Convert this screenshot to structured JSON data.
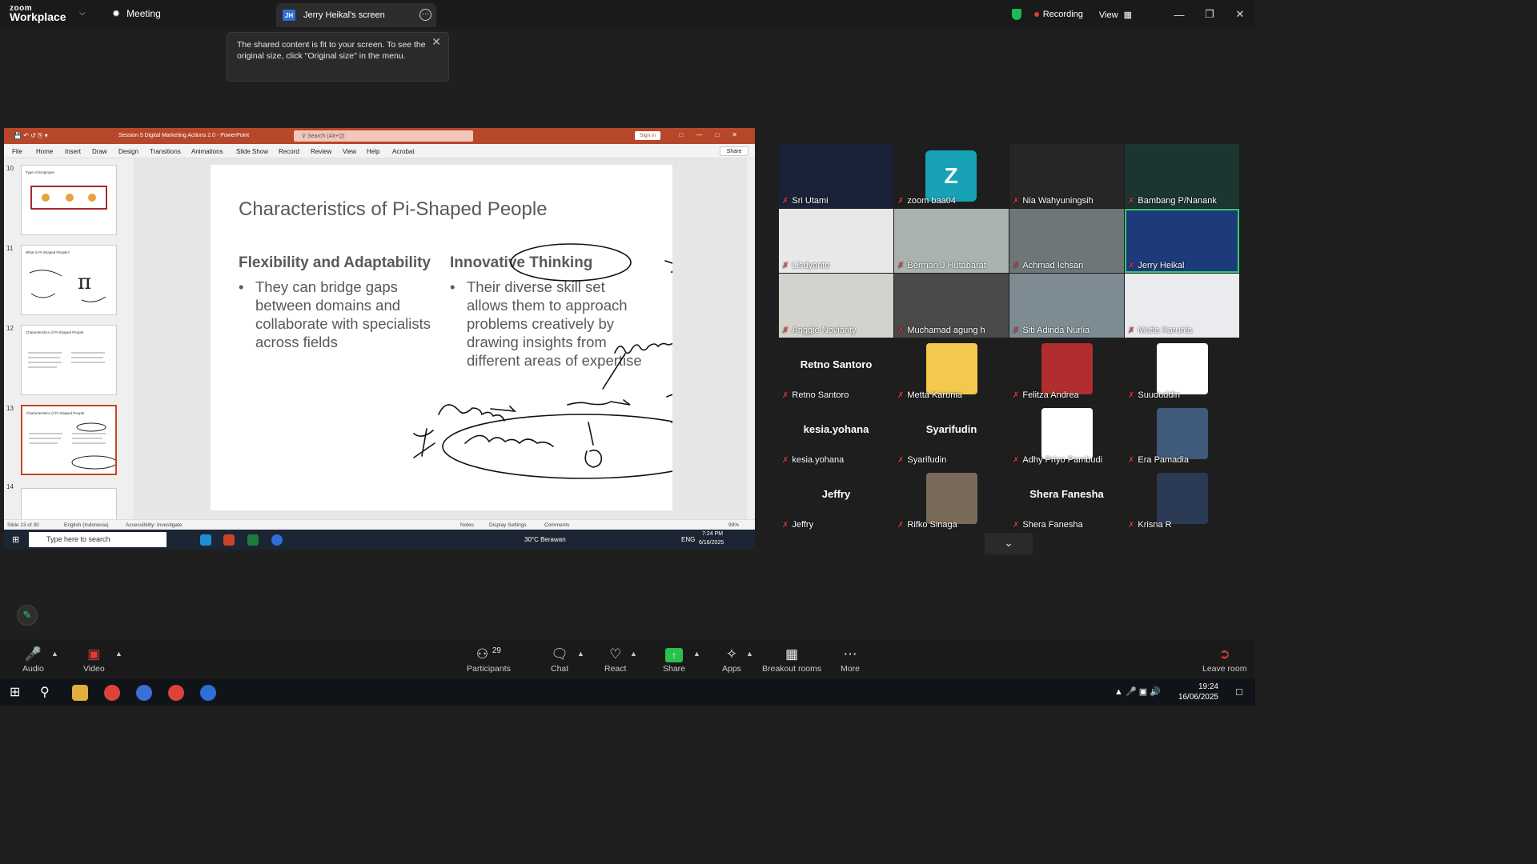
{
  "zoom": {
    "brand_line1": "zoom",
    "brand_line2": "Workplace",
    "meeting_tab": "Meeting",
    "screen_tab": "Jerry Heikal's screen",
    "screen_tab_badge": "JH",
    "recording": "Recording",
    "view": "View",
    "notice": "The shared content is fit to your screen. To see the original size, click \"Original size\" in the menu."
  },
  "ppt": {
    "title": "Session 5 Digital Marketing Actions 2.0  -  PowerPoint",
    "search_placeholder": "Search (Alt+Q)",
    "sign_in": "Sign in",
    "menu": [
      "File",
      "Home",
      "Insert",
      "Draw",
      "Design",
      "Transitions",
      "Animations",
      "Slide Show",
      "Record",
      "Review",
      "View",
      "Help",
      "Acrobat"
    ],
    "share": "Share",
    "thumbnails": [
      {
        "num": "10",
        "title": "Type of Employee"
      },
      {
        "num": "11",
        "title": "What is Pi-Shaped People?"
      },
      {
        "num": "12",
        "title": "Characteristics of Pi-Shaped People"
      },
      {
        "num": "13",
        "title": "Characteristics of Pi-Shaped People"
      },
      {
        "num": "14",
        "title": ""
      }
    ],
    "slide": {
      "title": "Characteristics of Pi-Shaped People",
      "col1_heading": "Flexibility and Adaptability",
      "col1_bullet": "They can bridge gaps between domains and collaborate with specialists across fields",
      "col2_heading": "Innovative Thinking",
      "col2_bullet": "Their diverse skill set allows them to approach problems creatively by drawing insights from different areas of expertise"
    },
    "status": {
      "slide_of": "Slide 13 of 30",
      "language": "English (Indonesia)",
      "accessibility": "Accessibility: Investigate",
      "notes": "Notes",
      "display": "Display Settings",
      "comments": "Comments",
      "zoom": "99%"
    },
    "taskbar": {
      "search": "Type here to search",
      "weather": "30°C  Berawan",
      "lang": "ENG",
      "time": "7:24 PM",
      "date": "6/16/2025"
    }
  },
  "participants": [
    {
      "name": "Sri Utami",
      "bg": "#1a2238"
    },
    {
      "name": "zoom baa04",
      "bg": "#1e1e1e",
      "avatar": "Z"
    },
    {
      "name": "Nia Wahyuningsih",
      "bg": "#262626"
    },
    {
      "name": "Bambang P/Nanank",
      "bg": "#1c3530"
    },
    {
      "name": "Lisdyanto",
      "bg": "#e8e8e8"
    },
    {
      "name": "Berman J Hutabarat",
      "bg": "#a9b3ad"
    },
    {
      "name": "Achmad Ichsan",
      "bg": "#6f7678"
    },
    {
      "name": "Jerry Heikal",
      "bg": "#1d3b7a"
    },
    {
      "name": "Anggie Novianty",
      "bg": "#d4d2cc"
    },
    {
      "name": "Muchamad agung h",
      "bg": "#4a4a48"
    },
    {
      "name": "Siti Adinda Nurlia",
      "bg": "#7d8b93"
    },
    {
      "name": "Mutia Karunia",
      "bg": "#e9ebef"
    },
    {
      "name": "Retno Santoro",
      "big": "Retno Santoro"
    },
    {
      "name": "Metta Karunia"
    },
    {
      "name": "Felitza Andrea"
    },
    {
      "name": "Suududdin"
    },
    {
      "name": "kesia.yohana",
      "big": "kesia.yohana"
    },
    {
      "name": "Syarifudin",
      "big": "Syarifudin"
    },
    {
      "name": "Adhy Priyo Pambudi"
    },
    {
      "name": "Era Pamadia"
    },
    {
      "name": "Jeffry",
      "big": "Jeffry"
    },
    {
      "name": "Rifko Sinaga"
    },
    {
      "name": "Shera Fanesha",
      "big": "Shera Fanesha"
    },
    {
      "name": "Krisna R"
    }
  ],
  "toolbar": {
    "audio": "Audio",
    "video": "Video",
    "participants": "Participants",
    "participants_count": "29",
    "chat": "Chat",
    "react": "React",
    "share": "Share",
    "apps": "Apps",
    "breakout": "Breakout rooms",
    "more": "More",
    "leave": "Leave room"
  },
  "windows": {
    "time": "19:24",
    "date": "16/06/2025"
  },
  "colors": {
    "ppt_accent": "#b7472a",
    "zoom_green": "#27c24c",
    "muted_red": "#e23b3b"
  }
}
